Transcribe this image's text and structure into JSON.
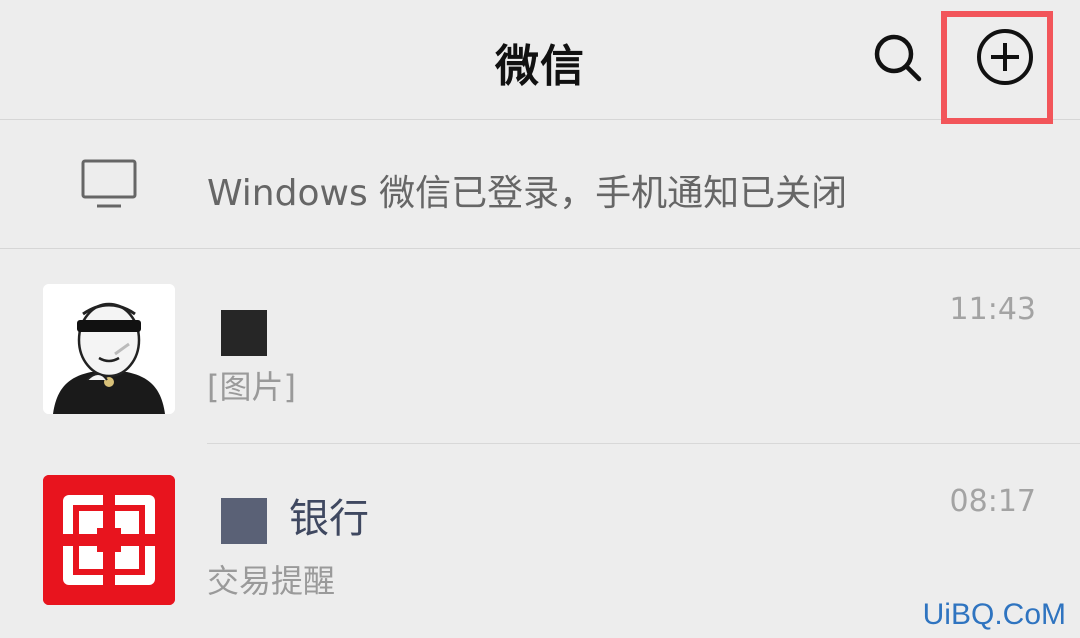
{
  "header": {
    "title": "微信",
    "search_icon": "search-icon",
    "add_icon": "plus-circle-icon",
    "highlight_color": "#f2555a"
  },
  "notice": {
    "icon": "monitor-icon",
    "text": "Windows 微信已登录，手机通知已关闭"
  },
  "chats": [
    {
      "name": "",
      "preview": "[图片]",
      "time": "11:43",
      "avatar": "meme-avatar"
    },
    {
      "name": "银行",
      "preview": "交易提醒",
      "time": "08:17",
      "avatar": "bank-logo",
      "avatar_color": "#e8141e"
    }
  ],
  "watermark": "UiBQ.CoM"
}
